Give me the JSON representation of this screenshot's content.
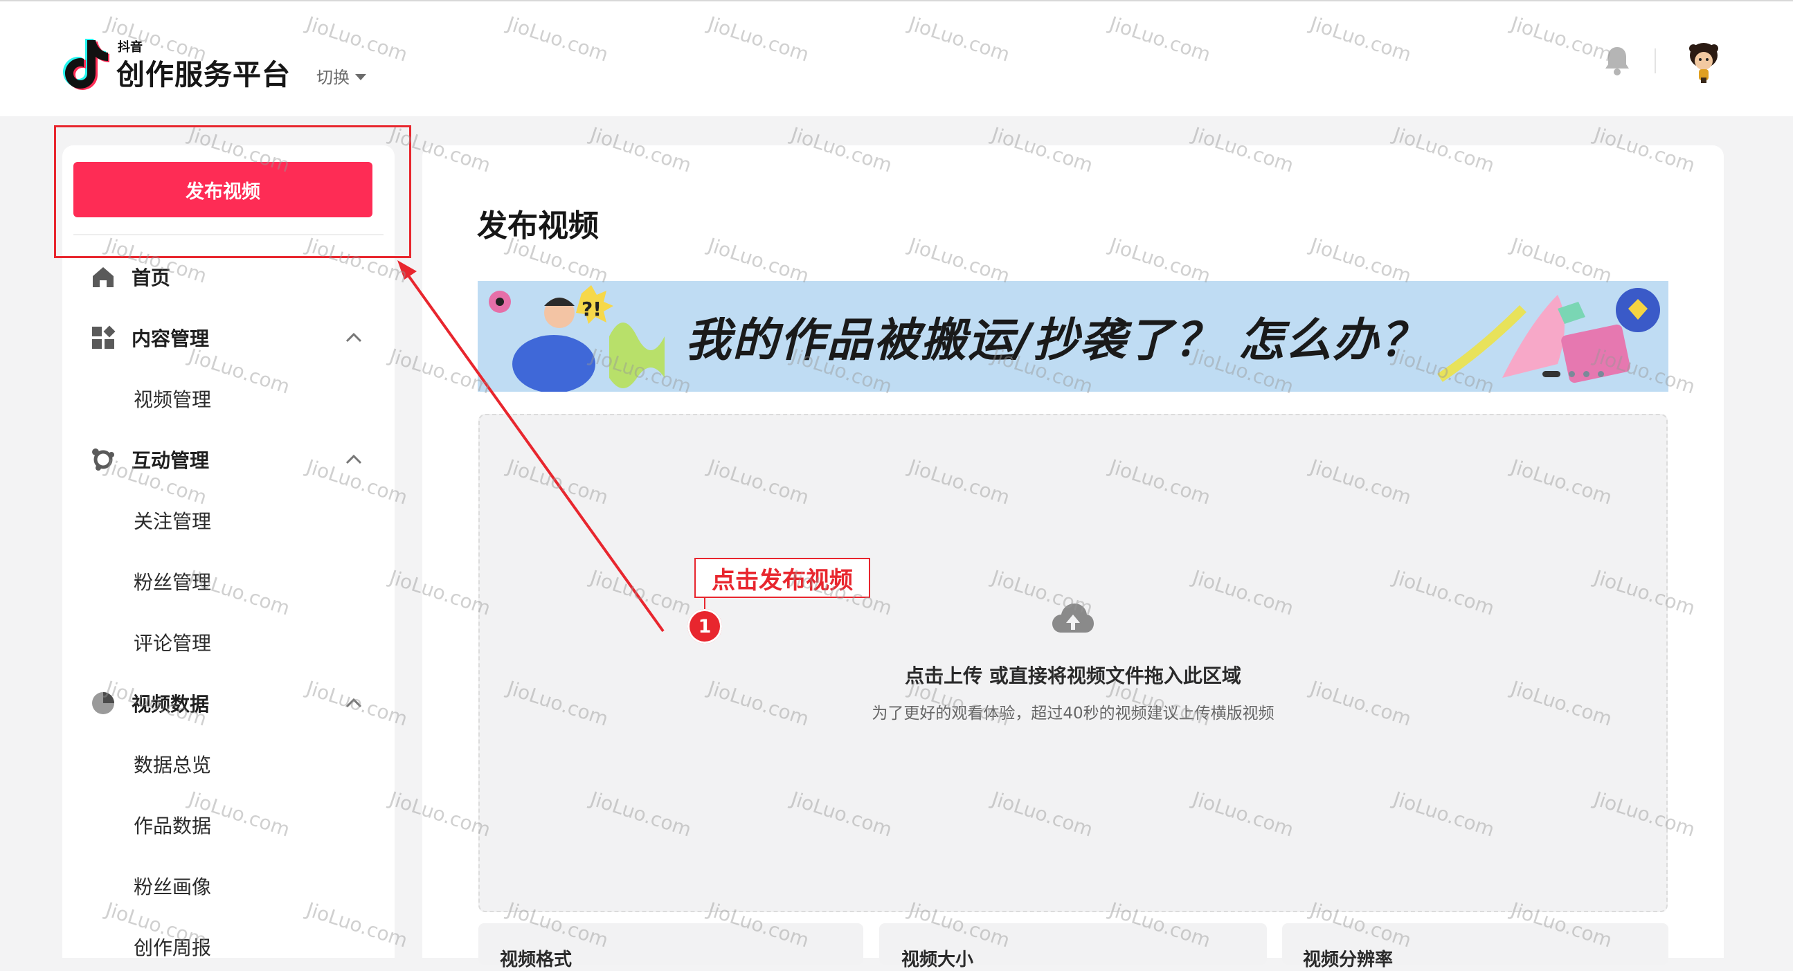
{
  "header": {
    "logo_small": "抖音",
    "logo_title": "创作服务平台",
    "switch_label": "切换"
  },
  "sidebar": {
    "publish_button": "发布视频",
    "items": [
      {
        "label": "首页",
        "icon": "home-icon"
      },
      {
        "label": "内容管理",
        "icon": "grid-icon",
        "expanded": true,
        "children": [
          "视频管理"
        ]
      },
      {
        "label": "互动管理",
        "icon": "interaction-icon",
        "expanded": true,
        "children": [
          "关注管理",
          "粉丝管理",
          "评论管理"
        ]
      },
      {
        "label": "视频数据",
        "icon": "pie-chart-icon",
        "expanded": true,
        "children": [
          "数据总览",
          "作品数据",
          "粉丝画像",
          "创作周报"
        ]
      }
    ]
  },
  "main": {
    "title": "发布视频",
    "banner_text": "我的作品被搬运/抄袭了？ 怎么办？",
    "upload": {
      "primary": "点击上传 或直接将视频文件拖入此区域",
      "secondary": "为了更好的观看体验，超过40秒的视频建议上传横版视频"
    },
    "spec_cards": [
      "视频格式",
      "视频大小",
      "视频分辨率"
    ]
  },
  "annotation": {
    "label": "点击发布视频",
    "badge": "1",
    "color": "#e8262e"
  },
  "watermark": "JioLuo.com",
  "colors": {
    "brand": "#fe2c55",
    "annotation": "#e8262e"
  }
}
